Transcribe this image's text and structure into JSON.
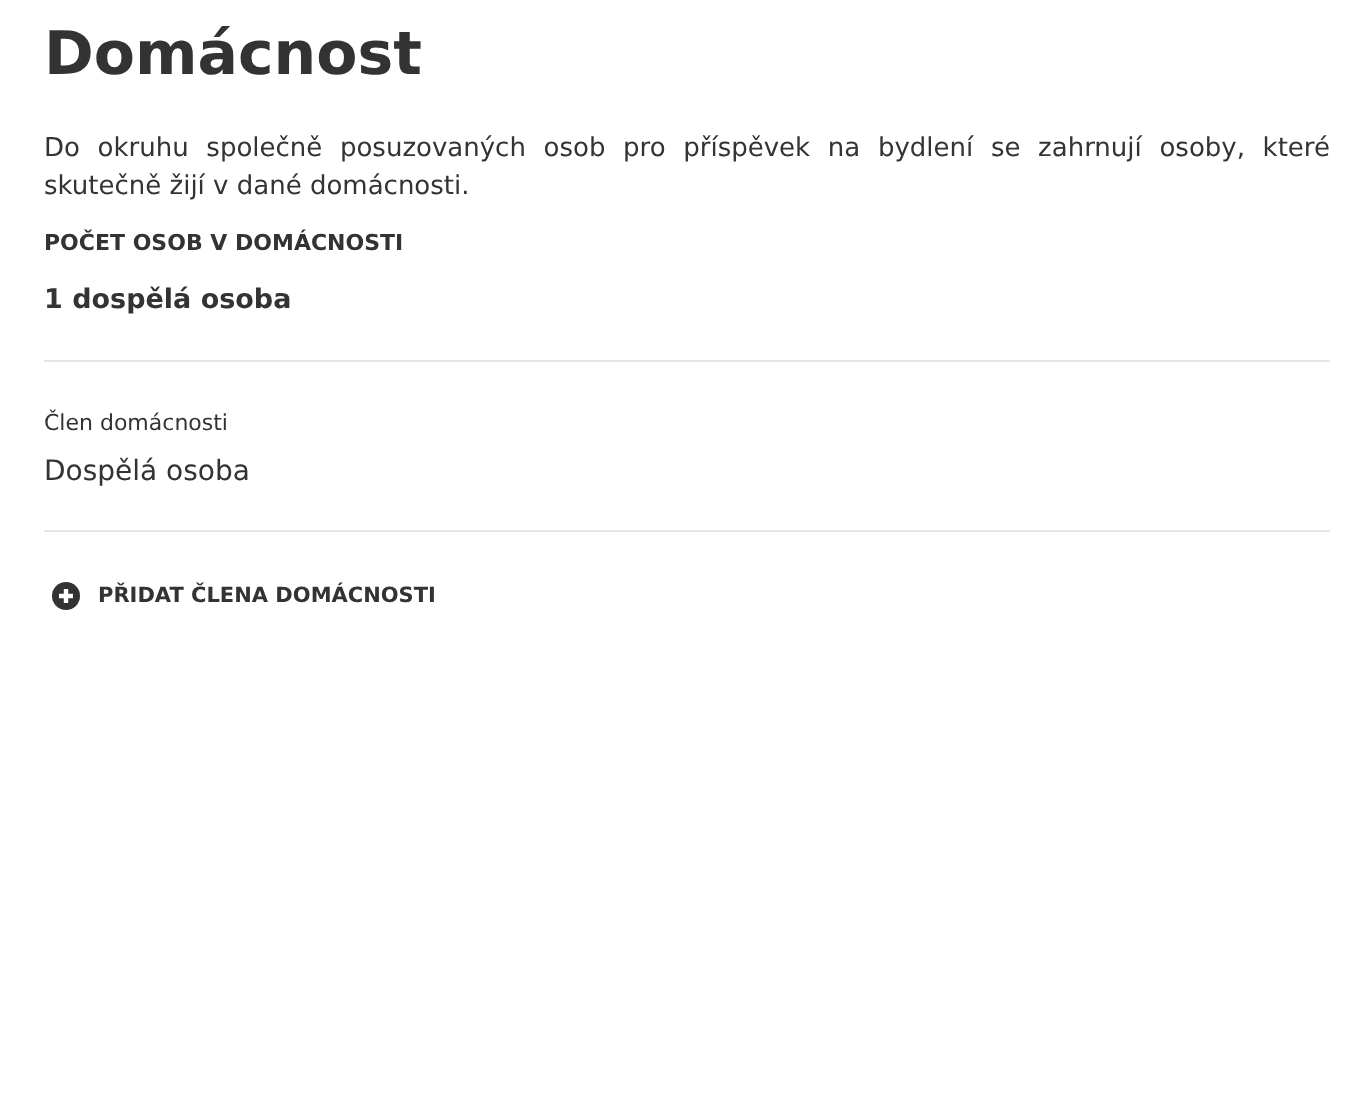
{
  "title": "Domácnost",
  "description": "Do okruhu společně posuzovaných osob pro příspěvek na bydlení se zahrnují osoby, které skutečně žijí v dané domácnosti.",
  "count_label": "POČET OSOB V DOMÁCNOSTI",
  "count_value": "1 dospělá osoba",
  "members": [
    {
      "label": "Člen domácnosti",
      "value": "Dospělá osoba"
    }
  ],
  "add_button": "PŘIDAT ČLENA DOMÁCNOSTI"
}
